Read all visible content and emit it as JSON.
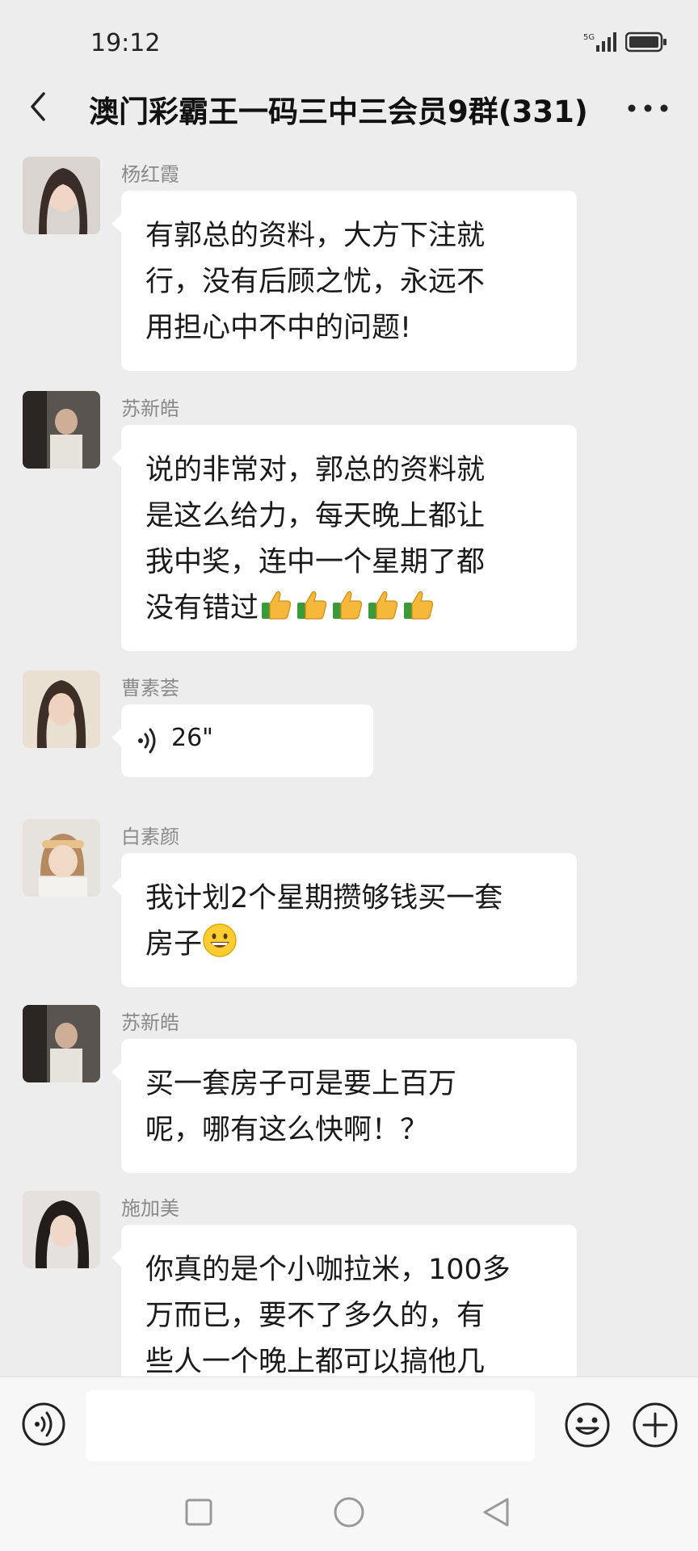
{
  "status": {
    "time": "19:12",
    "network": "5G"
  },
  "header": {
    "title": "澳门彩霸王一码三中三会员9群(331)"
  },
  "messages": [
    {
      "sender": "杨红霞",
      "lines": [
        "有郭总的资料，大方下注就",
        "行，没有后顾之忧，永远不",
        "用担心中不中的问题!"
      ]
    },
    {
      "sender": "苏新皓",
      "lines": [
        "说的非常对，郭总的资料就",
        "是这么给力，每天晚上都让",
        "我中奖，连中一个星期了都",
        "没有错过"
      ],
      "emoji": "👍",
      "emoji_count": 5
    },
    {
      "sender": "曹素荟",
      "voice_duration": "26\""
    },
    {
      "sender": "白素颜",
      "lines": [
        "我计划2个星期攒够钱买一套",
        "房子"
      ],
      "emoji": "😄"
    },
    {
      "sender": "苏新皓",
      "lines": [
        "买一套房子可是要上百万",
        "呢，哪有这么快啊！？"
      ]
    },
    {
      "sender": "施加美",
      "lines": [
        "你真的是个小咖拉米，100多",
        "万而已，要不了多久的，有",
        "些人一个晚上都可以搞他几"
      ]
    }
  ],
  "icons": {
    "back": "chevron-left-icon",
    "more": "more-dots-icon",
    "voice": "voice-wave-icon",
    "emoji": "smiley-icon",
    "plus": "plus-circle-icon"
  },
  "colors": {
    "background": "#ededed",
    "bubble": "#ffffff",
    "sender_name": "#8a8a8a"
  }
}
